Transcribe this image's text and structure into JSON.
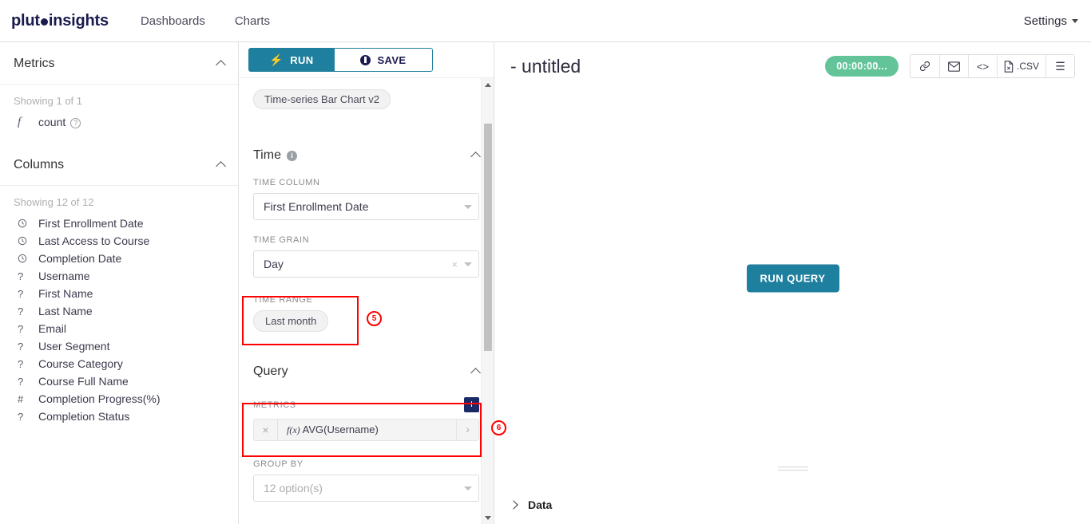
{
  "navbar": {
    "brand_pre": "plut",
    "brand_post": " insights",
    "links": [
      {
        "label": "Dashboards"
      },
      {
        "label": "Charts"
      }
    ],
    "settings_label": "Settings"
  },
  "datasource": {
    "metrics_section": {
      "title": "Metrics",
      "showing": "Showing 1 of 1",
      "items": [
        {
          "icon": "function-icon",
          "label": "count",
          "help": "?"
        }
      ]
    },
    "columns_section": {
      "title": "Columns",
      "showing": "Showing 12 of 12",
      "items": [
        {
          "icon": "clock-icon",
          "type": "temporal",
          "label": "First Enrollment Date"
        },
        {
          "icon": "clock-icon",
          "type": "temporal",
          "label": "Last Access to Course"
        },
        {
          "icon": "clock-icon",
          "type": "temporal",
          "label": "Completion Date"
        },
        {
          "icon": "question-icon",
          "type": "string",
          "label": "Username"
        },
        {
          "icon": "question-icon",
          "type": "string",
          "label": "First Name"
        },
        {
          "icon": "question-icon",
          "type": "string",
          "label": "Last Name"
        },
        {
          "icon": "question-icon",
          "type": "string",
          "label": "Email"
        },
        {
          "icon": "question-icon",
          "type": "string",
          "label": "User Segment"
        },
        {
          "icon": "question-icon",
          "type": "string",
          "label": "Course Category"
        },
        {
          "icon": "question-icon",
          "type": "string",
          "label": "Course Full Name"
        },
        {
          "icon": "hash-icon",
          "type": "numeric",
          "label": "Completion Progress(%)"
        },
        {
          "icon": "question-icon",
          "type": "string",
          "label": "Completion Status"
        }
      ]
    }
  },
  "control_panel": {
    "run_label": "RUN",
    "save_label": "SAVE",
    "chart_type": "Time-series Bar Chart v2",
    "time_section": {
      "title": "Time",
      "time_column_label": "TIME COLUMN",
      "time_column_value": "First Enrollment Date",
      "time_grain_label": "TIME GRAIN",
      "time_grain_value": "Day",
      "time_range_label": "TIME RANGE",
      "time_range_value": "Last month"
    },
    "query_section": {
      "title": "Query",
      "metrics_label": "METRICS",
      "add_label": "+",
      "metric_chip": {
        "fx": "f(x)",
        "value": "AVG(Username)",
        "remove": "×",
        "expand": "›"
      },
      "group_by_label": "GROUP BY",
      "group_by_placeholder": "12 option(s)"
    }
  },
  "chart": {
    "title": "- untitled",
    "timer": "00:00:00...",
    "toolbar": [
      {
        "icon": "link-icon",
        "glyph": "🔗",
        "label": ""
      },
      {
        "icon": "email-icon",
        "glyph": "✉",
        "label": ""
      },
      {
        "icon": "embed-code-icon",
        "glyph": "<>",
        "label": ""
      },
      {
        "icon": "csv-download-icon",
        "glyph": "",
        "label": ".CSV"
      },
      {
        "icon": "hamburger-menu-icon",
        "glyph": "☰",
        "label": ""
      }
    ],
    "run_query_label": "RUN QUERY",
    "data_panel_label": "Data"
  },
  "annotations": [
    {
      "badge": "5",
      "target": "time-range-control"
    },
    {
      "badge": "6",
      "target": "metrics-control"
    }
  ],
  "colors": {
    "teal": "#1f7f9e",
    "navy": "#1a1a4e",
    "green": "#63c49a",
    "annotation_red": "#ff0000"
  }
}
